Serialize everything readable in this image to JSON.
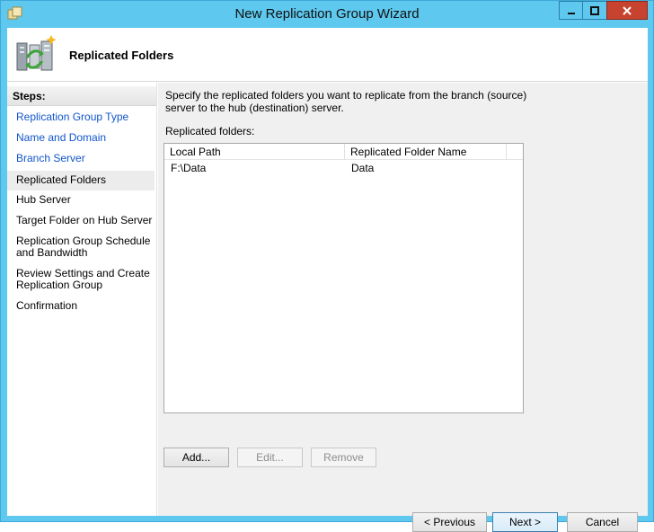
{
  "window": {
    "title": "New Replication Group Wizard"
  },
  "header": {
    "title": "Replicated Folders"
  },
  "steps": {
    "heading": "Steps:",
    "items": [
      {
        "label": "Replication Group Type",
        "state": "link"
      },
      {
        "label": "Name and Domain",
        "state": "link"
      },
      {
        "label": "Branch Server",
        "state": "link"
      },
      {
        "label": "Replicated Folders",
        "state": "current"
      },
      {
        "label": "Hub Server",
        "state": "plain"
      },
      {
        "label": "Target Folder on Hub Server",
        "state": "plain"
      },
      {
        "label": "Replication Group Schedule\nand Bandwidth",
        "state": "plain"
      },
      {
        "label": "Review Settings and Create\nReplication Group",
        "state": "plain"
      },
      {
        "label": "Confirmation",
        "state": "plain"
      }
    ]
  },
  "content": {
    "description": "Specify the replicated folders you want to replicate from the branch (source) server to the hub (destination) server.",
    "folders_label": "Replicated folders:",
    "columns": [
      "Local Path",
      "Replicated Folder Name"
    ],
    "rows": [
      {
        "local_path": "F:\\Data",
        "name": "Data"
      }
    ],
    "buttons": {
      "add": "Add...",
      "edit": "Edit...",
      "remove": "Remove"
    }
  },
  "footer": {
    "previous": "< Previous",
    "next": "Next >",
    "cancel": "Cancel"
  },
  "colors": {
    "titlebar": "#5ec8ee",
    "link": "#1155cc",
    "close": "#c7432f"
  }
}
